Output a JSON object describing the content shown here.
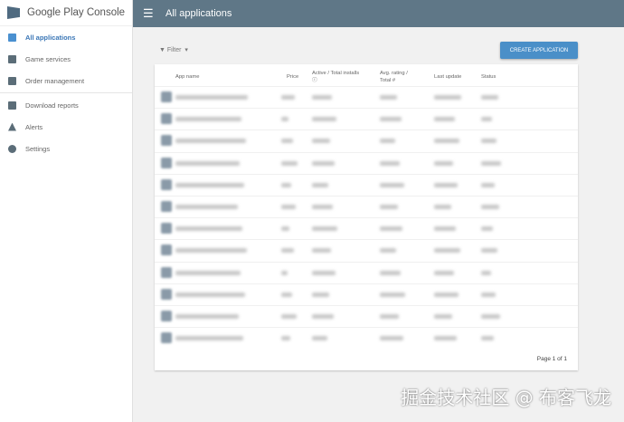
{
  "brand": "Google Play Console",
  "header": {
    "title": "All applications"
  },
  "sidebar": {
    "items": [
      {
        "label": "All applications"
      },
      {
        "label": "Game services"
      },
      {
        "label": "Order management"
      },
      {
        "label": "Download reports"
      },
      {
        "label": "Alerts"
      },
      {
        "label": "Settings"
      }
    ]
  },
  "toolbar": {
    "filter": "Filter",
    "create": "CREATE APPLICATION"
  },
  "table": {
    "headers": {
      "app": "App name",
      "price": "Price",
      "installs": "Active / Total installs",
      "rating": "Avg. rating / Total #",
      "update": "Last update",
      "status": "Status"
    },
    "row_count": 12
  },
  "pager": "Page 1 of 1",
  "watermark": "掘金技术社区 @ 布客飞龙",
  "colors": {
    "topbar": "#5f7787",
    "accent": "#4a8fc8"
  }
}
